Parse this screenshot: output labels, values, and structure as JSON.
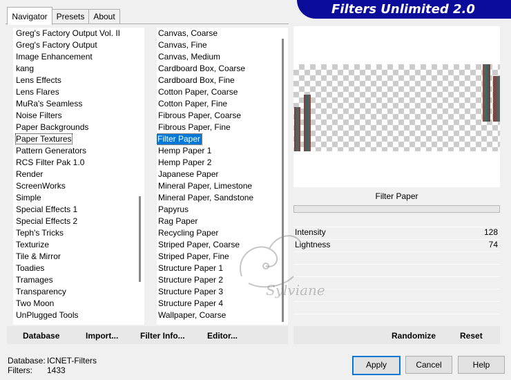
{
  "tabs": [
    {
      "label": "Navigator",
      "active": true
    },
    {
      "label": "Presets",
      "active": false
    },
    {
      "label": "About",
      "active": false
    }
  ],
  "title": "Filters Unlimited 2.0",
  "categories": [
    "Greg's Factory Output Vol. II",
    "Greg's Factory Output",
    "Image Enhancement",
    "kang",
    "Lens Effects",
    "Lens Flares",
    "MuRa's Seamless",
    "Noise Filters",
    "Paper Backgrounds",
    "Paper Textures",
    "Pattern Generators",
    "RCS Filter Pak 1.0",
    "Render",
    "ScreenWorks",
    "Simple",
    "Special Effects 1",
    "Special Effects 2",
    "Teph's Tricks",
    "Texturize",
    "Tile & Mirror",
    "Toadies",
    "Tramages",
    "Transparency",
    "Two Moon",
    "UnPlugged Tools"
  ],
  "selected_category": "Paper Textures",
  "filters": [
    "Canvas, Coarse",
    "Canvas, Fine",
    "Canvas, Medium",
    "Cardboard Box, Coarse",
    "Cardboard Box, Fine",
    "Cotton Paper, Coarse",
    "Cotton Paper, Fine",
    "Fibrous Paper, Coarse",
    "Fibrous Paper, Fine",
    "Filter Paper",
    "Hemp Paper 1",
    "Hemp Paper 2",
    "Japanese Paper",
    "Mineral Paper, Limestone",
    "Mineral Paper, Sandstone",
    "Papyrus",
    "Rag Paper",
    "Recycling Paper",
    "Striped Paper, Coarse",
    "Striped Paper, Fine",
    "Structure Paper 1",
    "Structure Paper 2",
    "Structure Paper 3",
    "Structure Paper 4",
    "Wallpaper, Coarse"
  ],
  "selected_filter": "Filter Paper",
  "preview": {
    "filter_name": "Filter Paper",
    "progress_fraction": 0.0
  },
  "params": [
    {
      "label": "Intensity",
      "value": "128"
    },
    {
      "label": "Lightness",
      "value": "74"
    }
  ],
  "left_buttons": {
    "database": "Database",
    "import": "Import...",
    "filter_info": "Filter Info...",
    "editor": "Editor..."
  },
  "right_buttons": {
    "randomize": "Randomize",
    "reset": "Reset"
  },
  "info": {
    "database_label": "Database:",
    "database_value": "ICNET-Filters",
    "filters_label": "Filters:",
    "filters_value": "1433"
  },
  "dialog_buttons": {
    "apply": "Apply",
    "cancel": "Cancel",
    "help": "Help"
  },
  "watermark": "Sylviane",
  "colors": {
    "banner": "#0c0c9a",
    "selection": "#0078d7"
  }
}
